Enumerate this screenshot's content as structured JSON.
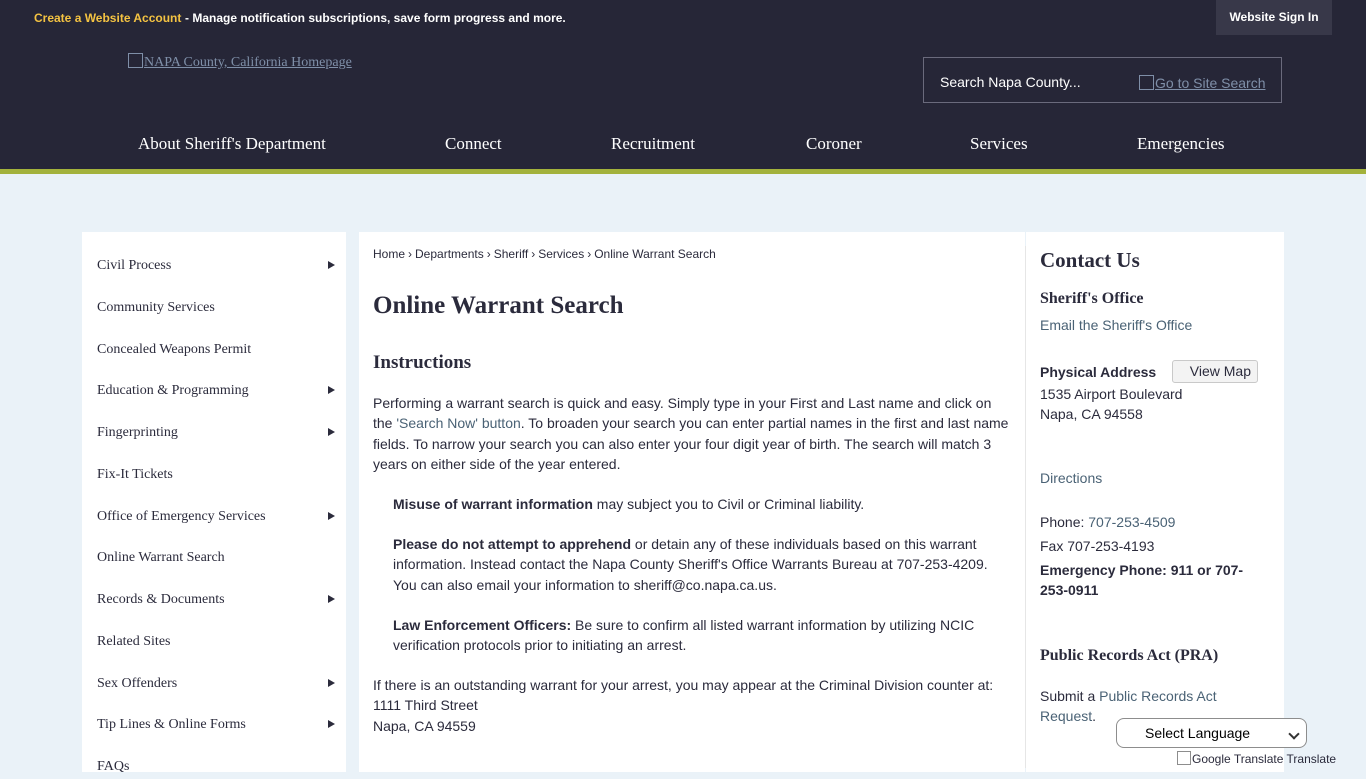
{
  "topbar": {
    "create_account": "Create a Website Account",
    "manage_text": "- Manage notification subscriptions, save form progress and more.",
    "sign_in": "Website Sign In"
  },
  "header": {
    "logo_alt": "NAPA County, California Homepage",
    "search_placeholder": "Search Napa County...",
    "search_button_alt": "Go to Site Search"
  },
  "nav": {
    "items": [
      "About Sheriff's Department",
      "Connect",
      "Recruitment",
      "Coroner",
      "Services",
      "Emergencies"
    ]
  },
  "sidebar": {
    "items": [
      {
        "label": "Civil Process",
        "has_sub": true
      },
      {
        "label": "Community Services",
        "has_sub": false
      },
      {
        "label": "Concealed Weapons Permit",
        "has_sub": false
      },
      {
        "label": "Education & Programming",
        "has_sub": true
      },
      {
        "label": "Fingerprinting",
        "has_sub": true
      },
      {
        "label": "Fix-It Tickets",
        "has_sub": false
      },
      {
        "label": "Office of Emergency Services",
        "has_sub": true
      },
      {
        "label": "Online Warrant Search",
        "has_sub": false
      },
      {
        "label": "Records & Documents",
        "has_sub": true
      },
      {
        "label": "Related Sites",
        "has_sub": false
      },
      {
        "label": "Sex Offenders",
        "has_sub": true
      },
      {
        "label": "Tip Lines & Online Forms",
        "has_sub": true
      },
      {
        "label": "FAQs",
        "has_sub": false
      }
    ]
  },
  "breadcrumb": {
    "items": [
      "Home",
      "Departments",
      "Sheriff",
      "Services"
    ],
    "current": "Online Warrant Search",
    "separator": "›"
  },
  "main": {
    "title": "Online Warrant Search",
    "subtitle": "Instructions",
    "intro_a": "Performing a warrant search is quick and easy. Simply type in your First and Last name and click on the ",
    "intro_link": "'Search Now' button",
    "intro_b": ". To broaden your search you can enter partial names in the first and last name fields. To narrow your search you can also enter your four digit year of birth. The search will match 3 years on either side of the year entered.",
    "misuse_bold": "Misuse of warrant information",
    "misuse_rest": " may subject you to Civil or Criminal liability.",
    "apprehend_bold": "Please do not attempt to apprehend",
    "apprehend_rest": " or detain any of these individuals based on this warrant information. Instead contact the Napa County Sheriff's Office Warrants Bureau at 707-253-4209. You can also email your information to sheriff@co.napa.ca.us.",
    "officers_bold": "Law Enforcement Officers:",
    "officers_rest": " Be sure to confirm all listed warrant information by utilizing NCIC verification protocols prior to initiating an arrest.",
    "outstanding": "If there is an outstanding warrant for your arrest, you may appear at the Criminal Division counter at:",
    "address_line1": "1111 Third Street",
    "address_line2": "Napa, CA 94559"
  },
  "contact": {
    "title": "Contact Us",
    "office": "Sheriff's Office",
    "email_link": "Email the Sheriff's Office",
    "physical_label": "Physical Address",
    "view_map": "View Map",
    "street": "1535 Airport Boulevard",
    "city": "Napa, CA 94558",
    "directions": "Directions",
    "phone_label": "Phone: ",
    "phone": "707-253-4509",
    "fax": "Fax 707-253-4193",
    "emergency": "Emergency Phone: 911 or 707-253-0911",
    "pra_title": "Public Records Act (PRA)",
    "pra_text": "Submit a ",
    "pra_link": "Public Records Act Request",
    "pra_end": "."
  },
  "translate": {
    "select_label": "Select Language",
    "google_alt": "Google Translate",
    "translate_text": "Translate"
  }
}
